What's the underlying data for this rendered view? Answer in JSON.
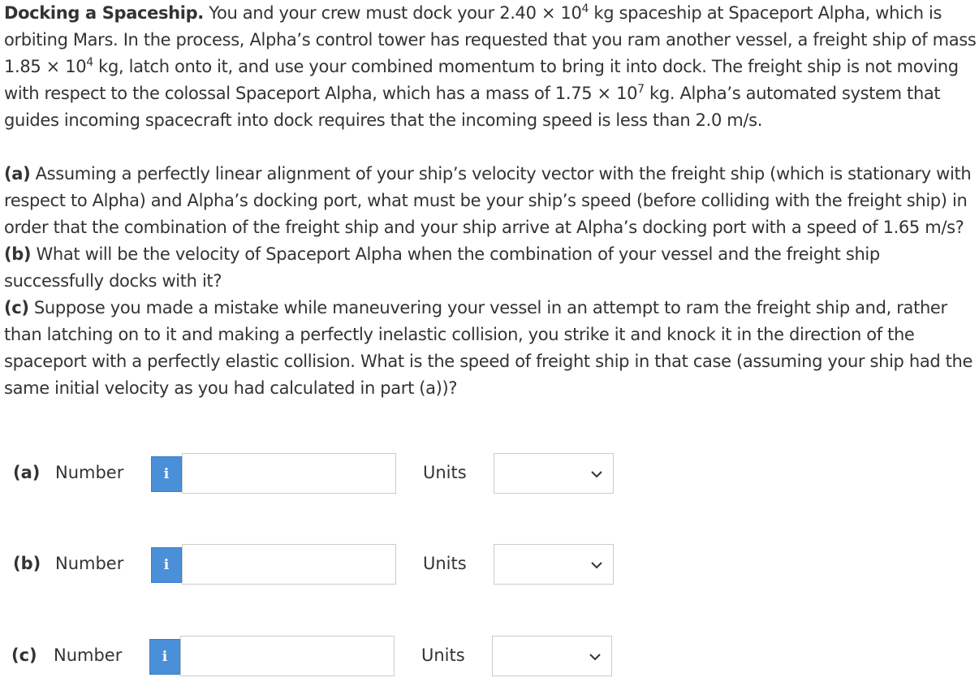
{
  "problem": {
    "title": "Docking a Spaceship.",
    "intro_part1": " You and your crew must dock your 2.40 × 10",
    "exp1": "4",
    "intro_part2": " kg spaceship at Spaceport Alpha, which is orbiting Mars. In the process, Alpha’s control tower has requested that you ram another vessel, a freight ship of mass 1.85 × 10",
    "exp2": "4",
    "intro_part3": " kg, latch onto it, and use your combined momentum to bring it into dock. The freight ship is not moving with respect to the colossal Spaceport Alpha, which has a mass of 1.75 × 10",
    "exp3": "7",
    "intro_part4": " kg. Alpha’s automated system that guides incoming spacecraft into dock requires that the incoming speed is less than 2.0 m/s.",
    "questions": [
      {
        "label": "(a)",
        "text": " Assuming a perfectly linear alignment of your ship’s velocity vector with the freight ship (which is stationary with respect to Alpha) and Alpha’s docking port, what must be your ship’s speed (before colliding with the freight ship) in order that the combination of the freight ship and your ship arrive at Alpha’s docking port with a speed of 1.65 m/s?"
      },
      {
        "label": "(b)",
        "text": " What will be the velocity of Spaceport Alpha when the combination of your vessel and the freight ship successfully docks with it?"
      },
      {
        "label": "(c)",
        "text": " Suppose you made a mistake while maneuvering your vessel in an attempt to ram the freight ship and, rather than latching on to it and making a perfectly inelastic collision, you strike it and knock it in the direction of the spaceport with a perfectly elastic collision. What is the speed of freight ship in that case (assuming your ship had the same initial velocity as you had calculated in part (a))?"
      }
    ]
  },
  "answers": [
    {
      "part_label": "(a)",
      "number_label": "Number",
      "info_glyph": "i",
      "number_value": "",
      "units_label": "Units",
      "units_value": "",
      "chevron": "chevron-down-icon"
    },
    {
      "part_label": "(b)",
      "number_label": "Number",
      "info_glyph": "i",
      "number_value": "",
      "units_label": "Units",
      "units_value": "",
      "chevron": "chevron-down-icon"
    },
    {
      "part_label": "(c)",
      "number_label": "Number",
      "info_glyph": "i",
      "number_value": "",
      "units_label": "Units",
      "units_value": "",
      "chevron": "chevron-down-icon"
    }
  ],
  "colors": {
    "info_button": "#4a90d9",
    "text": "#333333",
    "input_border": "#cccccc"
  }
}
